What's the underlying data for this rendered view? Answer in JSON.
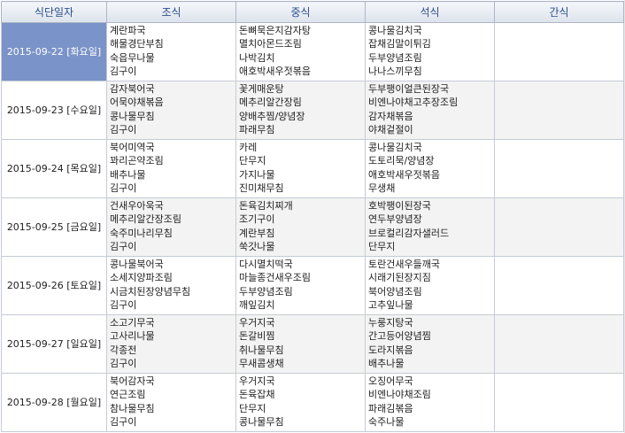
{
  "headers": [
    "식단일자",
    "조식",
    "중식",
    "석식",
    "간식"
  ],
  "rows": [
    {
      "date": "2015-09-22 [화요일]",
      "selected": true,
      "breakfast": [
        "계란파국",
        "해물경단부침",
        "숙읍무나물",
        "김구이"
      ],
      "lunch": [
        "돈뼈묵은지감자탕",
        "멸치아몬드조림",
        "나박김치",
        "애호박새우젓볶음"
      ],
      "dinner": [
        "콩나물김치국",
        "잡채김말이튀김",
        "두부양념조림",
        "나나스끼무침"
      ],
      "snack": []
    },
    {
      "date": "2015-09-23 [수요일]",
      "selected": false,
      "breakfast": [
        "감자북어국",
        "어묵야채볶음",
        "콩나물무침",
        "김구이"
      ],
      "lunch": [
        "꽃게매운탕",
        "메추리알간장림",
        "양배추찜/양념장",
        "파래무침"
      ],
      "dinner": [
        "두부팽이얼큰된장국",
        "비엔나야채고추장조림",
        "감자채볶음",
        "야채겉절이"
      ],
      "snack": []
    },
    {
      "date": "2015-09-24 [목요일]",
      "selected": false,
      "breakfast": [
        "북어미역국",
        "꽈리곤약조림",
        "배추나물",
        "김구이"
      ],
      "lunch": [
        "카레",
        "단무지",
        "가지나물",
        "진미채무침"
      ],
      "dinner": [
        "콩나물김치국",
        "도토리묵/양념장",
        "애호박새우젓볶음",
        "무생채"
      ],
      "snack": []
    },
    {
      "date": "2015-09-25 [금요일]",
      "selected": false,
      "breakfast": [
        "건새우아욱국",
        "메추리알간장조림",
        "숙주미나리무침",
        "김구이"
      ],
      "lunch": [
        "돈육김치찌개",
        "조기구이",
        "계란부침",
        "쑥갓나물"
      ],
      "dinner": [
        "호박팽이된장국",
        "연두부양념장",
        "브로컬리감자샐러드",
        "단무지"
      ],
      "snack": []
    },
    {
      "date": "2015-09-26 [토요일]",
      "selected": false,
      "breakfast": [
        "콩나물북어국",
        "소세지양파조림",
        "시금치된장양념무침",
        "김구이"
      ],
      "lunch": [
        "다시멸치떡국",
        "마늘종건새우조림",
        "두부양념조림",
        "깨잎김치"
      ],
      "dinner": [
        "토란건새우들깨국",
        "시래기된장지짐",
        "북어양념조림",
        "고추잎나물"
      ],
      "snack": []
    },
    {
      "date": "2015-09-27 [일요일]",
      "selected": false,
      "breakfast": [
        "소고기무국",
        "고사리나물",
        "각종전",
        "김구이"
      ],
      "lunch": [
        "우거지국",
        "돈갈비찜",
        "취나물무침",
        "무새콤생채"
      ],
      "dinner": [
        "누룽지탕국",
        "간고등어양념찜",
        "도라지볶음",
        "배추나물"
      ],
      "snack": []
    },
    {
      "date": "2015-09-28 [월요일]",
      "selected": false,
      "breakfast": [
        "북어감자국",
        "연근조림",
        "참나물무침",
        "김구이"
      ],
      "lunch": [
        "우거지국",
        "돈육잡채",
        "단무지",
        "콩나물무침"
      ],
      "dinner": [
        "오징어무국",
        "비엔나야채조림",
        "파래김볶음",
        "숙주나물"
      ],
      "snack": []
    }
  ]
}
